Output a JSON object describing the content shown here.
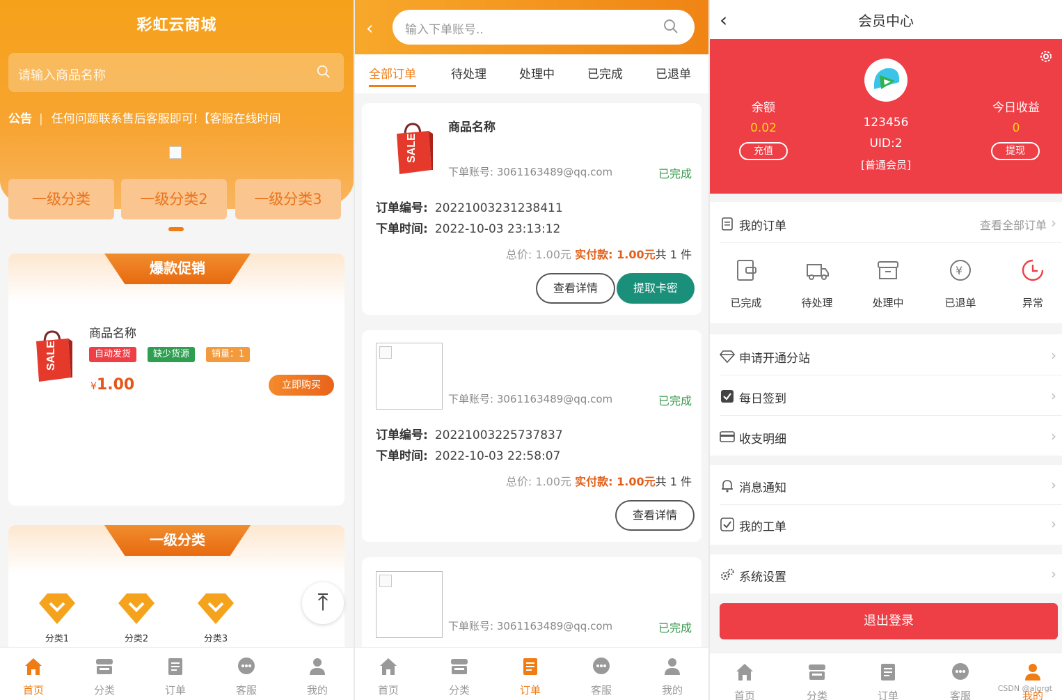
{
  "shop": {
    "title": "彩虹云商城",
    "search_placeholder": "请输入商品名称",
    "notice_label": "公告",
    "notice_text": "任何问题联系售后客服即可!【客服在线时间",
    "categories": [
      "一级分类",
      "一级分类2",
      "一级分类3"
    ],
    "promo_title": "爆款促销",
    "product": {
      "name": "商品名称",
      "tags": [
        "自动发货",
        "缺少货源",
        "销量：1"
      ],
      "currency": "¥",
      "price": "1.00",
      "buy_label": "立即购买"
    },
    "category_section_title": "一级分类",
    "sub_categories": [
      "分类1",
      "分类2",
      "分类3"
    ],
    "back_top_icon": "arrow-up-to-top-icon"
  },
  "tabbar": {
    "items": [
      "首页",
      "分类",
      "订单",
      "客服",
      "我的"
    ]
  },
  "orders": {
    "search_placeholder": "输入下单账号..",
    "tabs": [
      "全部订单",
      "待处理",
      "处理中",
      "已完成",
      "已退单"
    ],
    "labels": {
      "order_no": "订单编号:",
      "order_time": "下单时间:",
      "account": "下单账号:",
      "total_prefix": "总价: ",
      "pay_prefix": "实付款: ",
      "count_prefix": "共",
      "count_suffix": "件",
      "detail": "查看详情",
      "extract": "提取卡密"
    },
    "list": [
      {
        "product_name": "商品名称",
        "account": "3061163489@qq.com",
        "status": "已完成",
        "order_no": "2022100323123841​1",
        "order_time": "2022-10-03 23:13:12",
        "total": "1.00元",
        "paid": "1.00元",
        "count": "1"
      },
      {
        "account": "3061163489@qq.com",
        "status": "已完成",
        "order_no": "20221003225737837",
        "order_time": "2022-10-03 22:58:07",
        "total": "1.00元",
        "paid": "1.00元",
        "count": "1"
      },
      {
        "account": "3061163489@qq.com",
        "status": "已完成"
      }
    ]
  },
  "member": {
    "title": "会员中心",
    "balance_label": "余额",
    "balance": "0.02",
    "recharge": "充值",
    "today_label": "今日收益",
    "today": "0",
    "withdraw": "提现",
    "user_name": "123456",
    "uid": "UID:2",
    "level": "[普通会员]",
    "my_orders": "我的订单",
    "see_all": "查看全部订单",
    "order_status": [
      "已完成",
      "待处理",
      "处理中",
      "已退单",
      "异常"
    ],
    "menu_a": [
      "申请开通分站",
      "每日签到",
      "收支明细"
    ],
    "menu_b": [
      "消息通知",
      "我的工单"
    ],
    "settings": "系统设置",
    "logout": "退出登录",
    "watermark": "CSDN @algrgt"
  },
  "colors": {
    "orange": "#f07c14",
    "red": "#ee3e46",
    "green": "#3a9a4d",
    "teal": "#1a8f7a"
  }
}
